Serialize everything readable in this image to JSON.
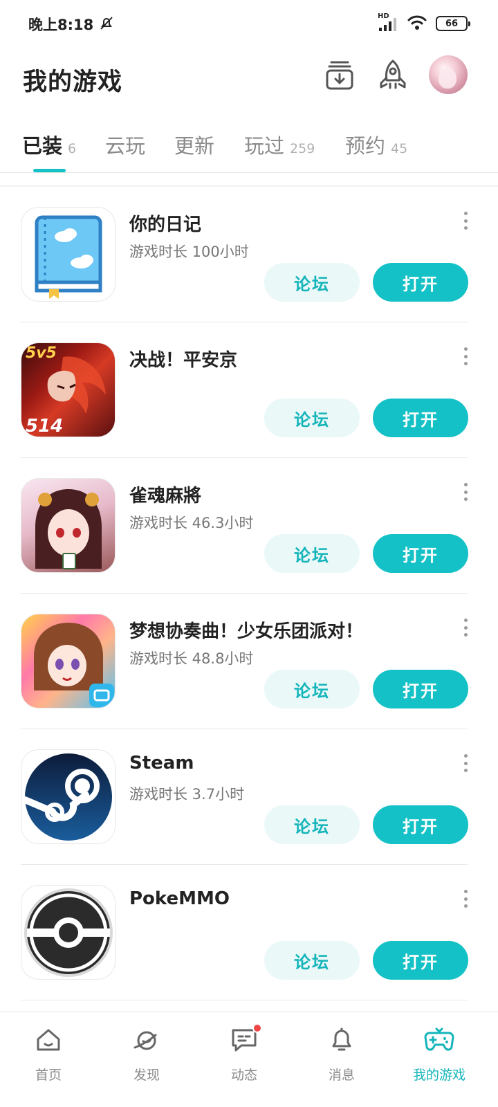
{
  "status_bar": {
    "time": "晚上8:18",
    "network": "HD",
    "battery": "66"
  },
  "header": {
    "title": "我的游戏",
    "icons": [
      "download-manager-icon",
      "rocket-icon",
      "avatar"
    ]
  },
  "tabs": [
    {
      "label": "已装",
      "count": "6",
      "active": true
    },
    {
      "label": "云玩",
      "count": ""
    },
    {
      "label": "更新",
      "count": ""
    },
    {
      "label": "玩过",
      "count": "259"
    },
    {
      "label": "预约",
      "count": "45"
    }
  ],
  "games": [
    {
      "name": "你的日记",
      "playtime": "游戏时长 100小时",
      "forum": "论坛",
      "open": "打开"
    },
    {
      "name": "决战！平安京",
      "playtime": "",
      "forum": "论坛",
      "open": "打开"
    },
    {
      "name": "雀魂麻將",
      "playtime": "游戏时长 46.3小时",
      "forum": "论坛",
      "open": "打开"
    },
    {
      "name": "梦想协奏曲！少女乐团派对！",
      "playtime": "游戏时长 48.8小时",
      "forum": "论坛",
      "open": "打开"
    },
    {
      "name": "Steam",
      "playtime": "游戏时长 3.7小时",
      "forum": "论坛",
      "open": "打开"
    },
    {
      "name": "PokeMMO",
      "playtime": "",
      "forum": "论坛",
      "open": "打开"
    }
  ],
  "game_icon_texts": {
    "onmyoji_badge": "5v5",
    "onmyoji_sub": "514"
  },
  "bottom_nav": [
    {
      "label": "首页",
      "icon": "home-icon"
    },
    {
      "label": "发现",
      "icon": "planet-icon"
    },
    {
      "label": "动态",
      "icon": "chat-icon",
      "badge": true
    },
    {
      "label": "消息",
      "icon": "bell-icon"
    },
    {
      "label": "我的游戏",
      "icon": "gamepad-icon",
      "active": true
    }
  ],
  "colors": {
    "accent": "#14c1c6",
    "forum_bg": "#eaf8f8",
    "badge_red": "#f04646"
  }
}
